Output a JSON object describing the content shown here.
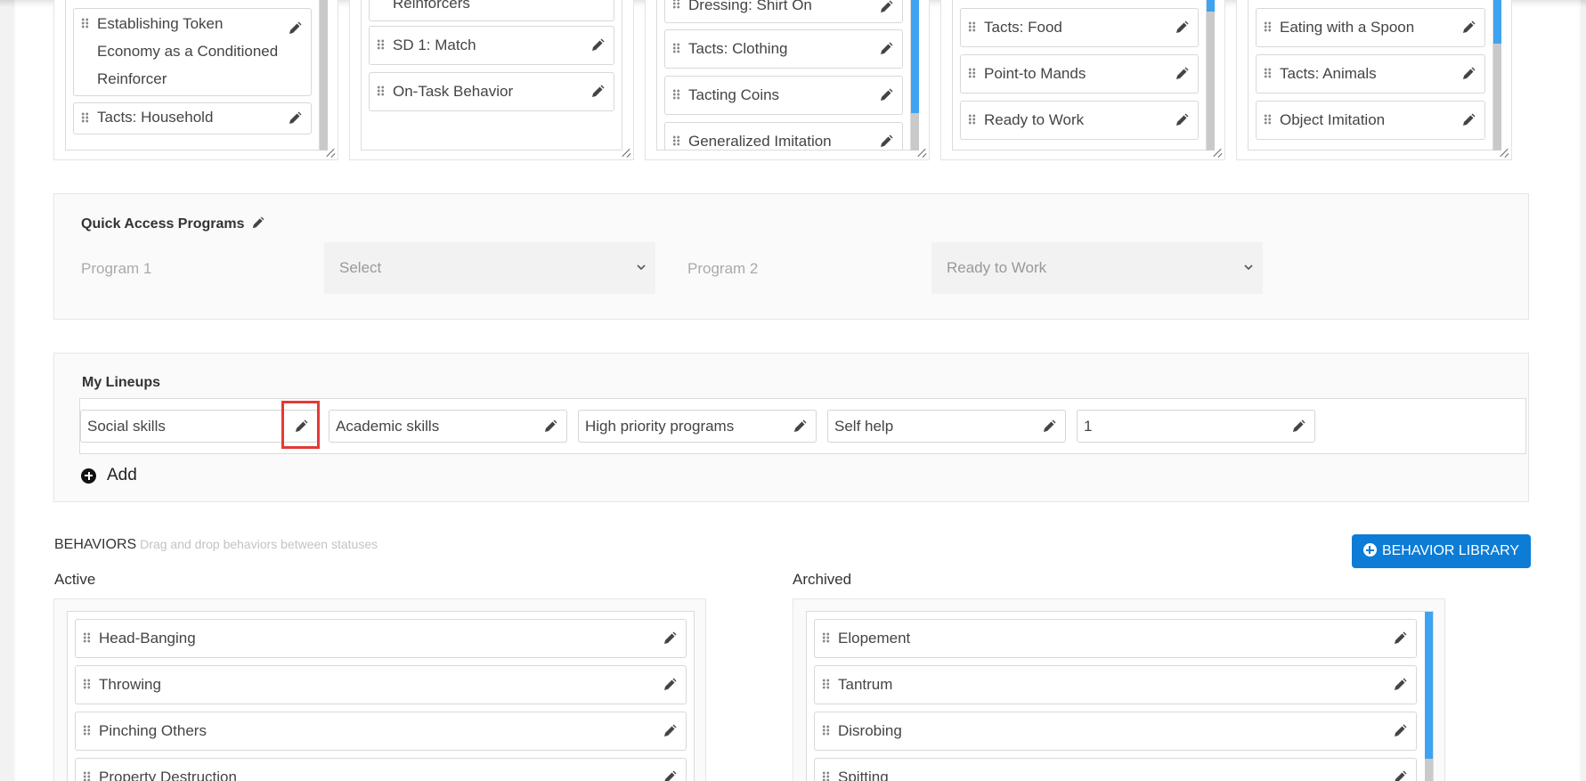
{
  "program_columns": [
    {
      "items": [
        "Establishing Token Economy as a Conditioned Reinforcer",
        "Tacts: Household"
      ]
    },
    {
      "items": [
        "Reinforcers",
        "SD 1: Match",
        "On-Task Behavior"
      ]
    },
    {
      "items": [
        "Dressing: Shirt On",
        "Tacts: Clothing",
        "Tacting Coins",
        "Generalized Imitation"
      ]
    },
    {
      "items": [
        "Tacts: Food",
        "Point-to Mands",
        "Ready to Work"
      ]
    },
    {
      "items": [
        "Eating with a Spoon",
        "Tacts: Animals",
        "Object Imitation"
      ]
    }
  ],
  "quick_access": {
    "title": "Quick Access Programs",
    "program1_label": "Program 1",
    "program1_value": "Select",
    "program2_label": "Program 2",
    "program2_value": "Ready to Work"
  },
  "lineups": {
    "title": "My Lineups",
    "items": [
      "Social skills",
      "Academic skills",
      "High priority programs",
      "Self help",
      "1"
    ],
    "add_label": "Add"
  },
  "behaviors": {
    "title": "BEHAVIORS",
    "hint": "Drag and drop behaviors between statuses",
    "library_button": "BEHAVIOR LIBRARY",
    "active_label": "Active",
    "archived_label": "Archived",
    "active": [
      "Head-Banging",
      "Throwing",
      "Pinching Others",
      "Property Destruction"
    ],
    "archived": [
      "Elopement",
      "Tantrum",
      "Disrobing",
      "Spitting"
    ]
  },
  "colors": {
    "accent": "#0d7cd6",
    "scroll_thumb": "#3ea3f0",
    "highlight": "#e53935"
  },
  "icons": {
    "edit": "pencil-icon",
    "drag": "drag-handle-icon",
    "dropdown": "chevron-down-icon",
    "add": "plus-circle-icon"
  }
}
